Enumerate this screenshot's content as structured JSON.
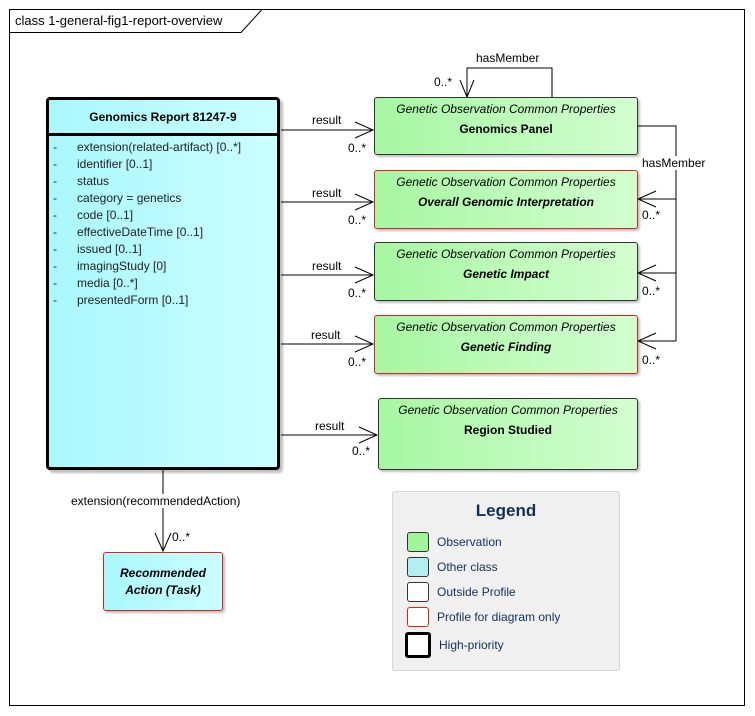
{
  "diagram": {
    "title": "class 1-general-fig1-report-overview"
  },
  "report_class": {
    "name": "Genomics Report 81247-9",
    "attributes": [
      {
        "visibility": "-",
        "text": "extension(related-artifact) [0..*]"
      },
      {
        "visibility": "-",
        "text": "identifier [0..1]"
      },
      {
        "visibility": "-",
        "text": "status"
      },
      {
        "visibility": "-",
        "text": "category = genetics"
      },
      {
        "visibility": "-",
        "text": "code [0..1]"
      },
      {
        "visibility": "-",
        "text": "effectiveDateTime [0..1]"
      },
      {
        "visibility": "-",
        "text": "issued [0..1]"
      },
      {
        "visibility": "-",
        "text": "imagingStudy [0]"
      },
      {
        "visibility": "-",
        "text": "media [0..*]"
      },
      {
        "visibility": "-",
        "text": "presentedForm [0..1]"
      }
    ]
  },
  "observations": [
    {
      "stereotype": "Genetic Observation Common Properties",
      "name": "Genomics Panel",
      "italic": false,
      "profile_for_diagram_only": false
    },
    {
      "stereotype": "Genetic Observation Common Properties",
      "name": "Overall Genomic Interpretation",
      "italic": true,
      "profile_for_diagram_only": true
    },
    {
      "stereotype": "Genetic Observation Common Properties",
      "name": "Genetic Impact",
      "italic": true,
      "profile_for_diagram_only": false
    },
    {
      "stereotype": "Genetic Observation Common Properties",
      "name": "Genetic Finding",
      "italic": true,
      "profile_for_diagram_only": true
    },
    {
      "stereotype": "Genetic Observation Common Properties",
      "name": "Region Studied",
      "italic": false,
      "profile_for_diagram_only": false
    }
  ],
  "associations": {
    "result_label": "result",
    "multiplicity": "0..*",
    "has_member_label": "hasMember",
    "extension_label": "extension(recommendedAction)"
  },
  "task_class": {
    "line1": "Recommended",
    "line2": "Action (Task)"
  },
  "legend": {
    "title": "Legend",
    "items": [
      {
        "label": "Observation",
        "color": "#a0f59c",
        "border": "#333333"
      },
      {
        "label": "Other class",
        "color": "#b1eff0",
        "border": "#333333"
      },
      {
        "label": "Outside Profile",
        "color": "#ffffff",
        "border": "#333333"
      },
      {
        "label": "Profile for diagram only",
        "color": "#ffffff",
        "border": "#e0201a"
      },
      {
        "label": "High-priority",
        "color": "#ffffff",
        "border": "#000000"
      }
    ]
  },
  "colors": {
    "observation_fill": "#b8f9b5",
    "other_class_fill": "#bdfcff",
    "profile_only_border": "#e0201a",
    "legend_text": "#10305a"
  }
}
